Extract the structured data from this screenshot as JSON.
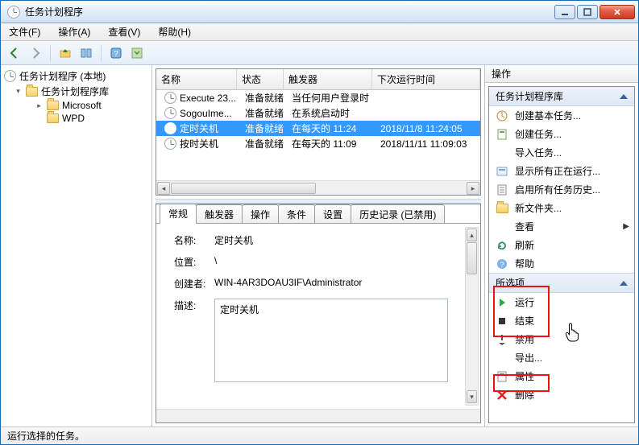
{
  "window": {
    "title": "任务计划程序"
  },
  "menu": {
    "file": "文件(F)",
    "action": "操作(A)",
    "view": "查看(V)",
    "help": "帮助(H)"
  },
  "tree": {
    "root": "任务计划程序 (本地)",
    "lib": "任务计划程序库",
    "ms": "Microsoft",
    "wpd": "WPD"
  },
  "grid": {
    "headers": {
      "name": "名称",
      "status": "状态",
      "trigger": "触发器",
      "next": "下次运行时间"
    },
    "rows": [
      {
        "name": "Execute 23...",
        "status": "准备就绪",
        "trigger": "当任何用户登录时",
        "next": ""
      },
      {
        "name": "SogouIme...",
        "status": "准备就绪",
        "trigger": "在系统启动时",
        "next": ""
      },
      {
        "name": "定时关机",
        "status": "准备就绪",
        "trigger": "在每天的 11:24",
        "next": "2018/11/8 11:24:05"
      },
      {
        "name": "按时关机",
        "status": "准备就绪",
        "trigger": "在每天的 11:09",
        "next": "2018/11/11 11:09:03"
      }
    ]
  },
  "tabs": {
    "general": "常规",
    "triggers": "触发器",
    "actions": "操作",
    "conditions": "条件",
    "settings": "设置",
    "history": "历史记录 (已禁用)"
  },
  "details": {
    "name_label": "名称:",
    "name_value": "定时关机",
    "loc_label": "位置:",
    "loc_value": "\\",
    "author_label": "创建者:",
    "author_value": "WIN-4AR3DOAU3IF\\Administrator",
    "desc_label": "描述:",
    "desc_value": "定时关机"
  },
  "actions": {
    "panel_title": "操作",
    "section_lib": "任务计划程序库",
    "create_basic": "创建基本任务...",
    "create": "创建任务...",
    "import": "导入任务...",
    "show_running": "显示所有正在运行...",
    "enable_history": "启用所有任务历史...",
    "new_folder": "新文件夹...",
    "view": "查看",
    "refresh": "刷新",
    "help": "帮助",
    "section_sel": "所选项",
    "run": "运行",
    "end": "结束",
    "disable": "禁用",
    "export": "导出...",
    "properties": "属性",
    "delete": "删除"
  },
  "status": "运行选择的任务。"
}
